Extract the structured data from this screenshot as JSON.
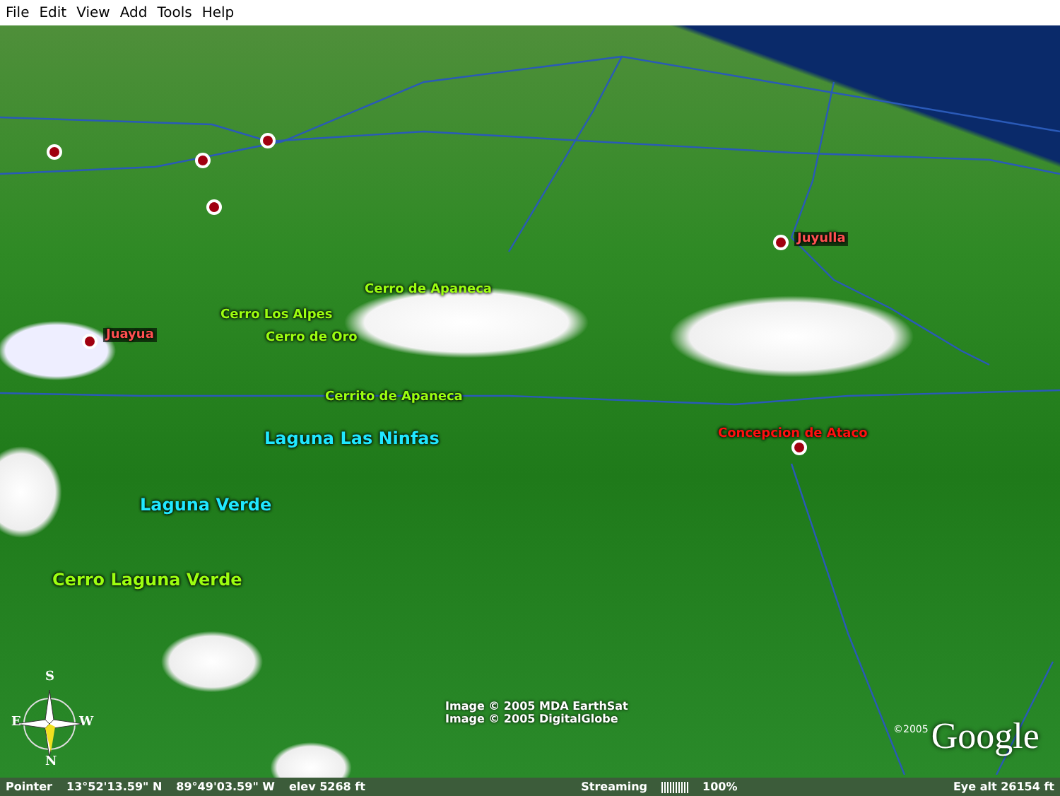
{
  "menu_bar": [
    "File",
    "Edit",
    "View",
    "Add",
    "Tools",
    "Help"
  ],
  "map": {
    "labels": [
      {
        "text": "Juayua",
        "kind": "town"
      },
      {
        "text": "Juyulla",
        "kind": "town"
      },
      {
        "text": "Cerro de Apaneca",
        "kind": "peak"
      },
      {
        "text": "Cerro Los Alpes",
        "kind": "peak"
      },
      {
        "text": "Cerro de Oro",
        "kind": "peak"
      },
      {
        "text": "Cerrito de Apaneca",
        "kind": "peak"
      },
      {
        "text": "Laguna Las Ninfas",
        "kind": "lake"
      },
      {
        "text": "Concepcion de Ataco",
        "kind": "town"
      },
      {
        "text": "Laguna Verde",
        "kind": "lake"
      },
      {
        "text": "Cerro Laguna Verde",
        "kind": "peak"
      }
    ],
    "compass": {
      "north": "N",
      "south": "S",
      "east": "E",
      "west": "W"
    },
    "credits": [
      "Image © 2005 MDA EarthSat",
      "Image © 2005 DigitalGlobe"
    ],
    "logo": {
      "year": "©2005",
      "name": "Google"
    }
  },
  "status_bar": {
    "pointer_label": "Pointer",
    "latitude": "13°52'13.59\"  N",
    "longitude": "89°49'03.59\"  W",
    "elevation": "elev  5268 ft",
    "streaming_label": "Streaming",
    "streaming": {
      "level": 1,
      "reading": "100%"
    },
    "eye_altitude": "Eye  alt   26154 ft"
  }
}
